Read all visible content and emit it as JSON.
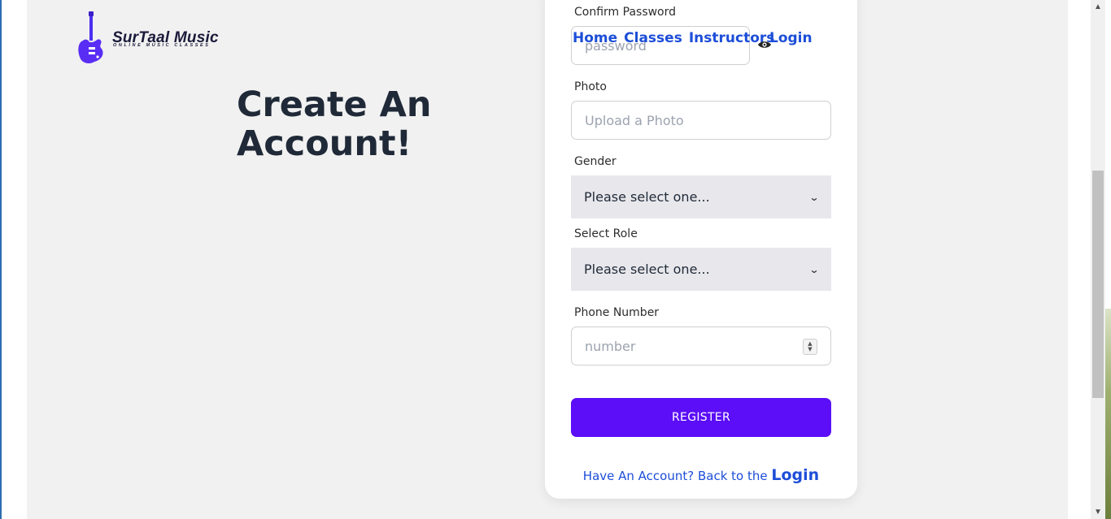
{
  "brand": {
    "name": "SurTaal Music",
    "tagline": "ONLINE MUSIC CLASSES"
  },
  "nav": {
    "home": "Home",
    "classes": "Classes",
    "instructors": "Instructors",
    "login": "Login"
  },
  "page": {
    "headline": "Create An Account!"
  },
  "form": {
    "confirm_password": {
      "label": "Confirm Password",
      "placeholder": "password"
    },
    "photo": {
      "label": "Photo",
      "placeholder": "Upload a Photo"
    },
    "gender": {
      "label": "Gender",
      "selected": "Please select one..."
    },
    "role": {
      "label": "Select Role",
      "selected": "Please select one..."
    },
    "phone": {
      "label": "Phone Number",
      "placeholder": "number"
    },
    "register_label": "REGISTER",
    "footer_text": "Have An Account? Back to the",
    "footer_link": "Login"
  },
  "colors": {
    "accent": "#5b0ef7",
    "link": "#1d4ed8",
    "heading": "#1f2937",
    "page_bg": "#f1f1f1"
  },
  "icons": {
    "logo": "guitar-icon",
    "password_toggle": "eye-icon",
    "select_arrow": "chevron-down-icon"
  }
}
